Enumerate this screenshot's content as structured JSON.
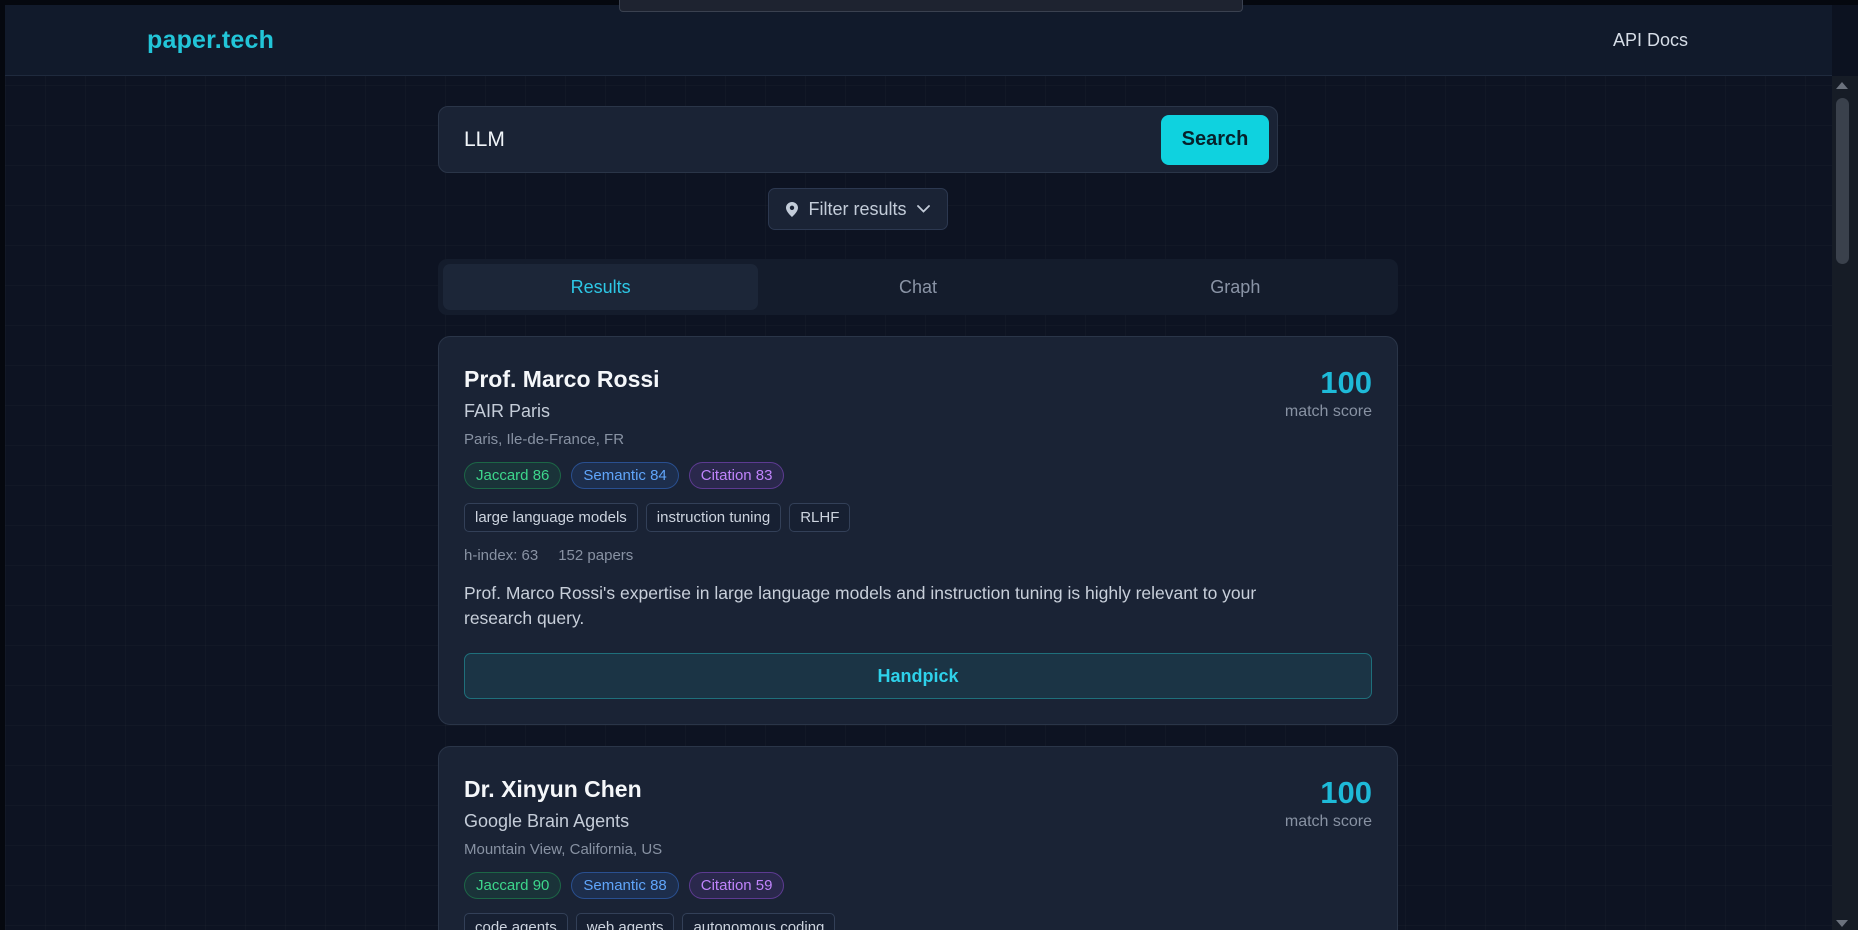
{
  "header": {
    "brand": "paper.tech",
    "api_docs": "API Docs"
  },
  "search": {
    "query": "LLM",
    "placeholder": "",
    "button": "Search"
  },
  "filter": {
    "label": "Filter results",
    "icon": "map-pin-icon",
    "chevron": "chevron-down-icon"
  },
  "tabs": [
    {
      "label": "Results",
      "active": true
    },
    {
      "label": "Chat",
      "active": false
    },
    {
      "label": "Graph",
      "active": false
    }
  ],
  "results": [
    {
      "name": "Prof. Marco Rossi",
      "org": "FAIR Paris",
      "location": "Paris, Ile-de-France, FR",
      "score": "100",
      "score_label": "match score",
      "metrics": {
        "jaccard": "Jaccard 86",
        "semantic": "Semantic 84",
        "citation": "Citation 83"
      },
      "tags": [
        "large language models",
        "instruction tuning",
        "RLHF"
      ],
      "h_index": "h-index: 63",
      "papers": "152 papers",
      "description": "Prof. Marco Rossi's expertise in large language models and instruction tuning is highly relevant to your research query.",
      "action": "Handpick"
    },
    {
      "name": "Dr. Xinyun Chen",
      "org": "Google Brain Agents",
      "location": "Mountain View, California, US",
      "score": "100",
      "score_label": "match score",
      "metrics": {
        "jaccard": "Jaccard 90",
        "semantic": "Semantic 88",
        "citation": "Citation 59"
      },
      "tags": [
        "code agents",
        "web agents",
        "autonomous coding"
      ]
    }
  ],
  "colors": {
    "accent": "#22c5d8",
    "background": "#0d1322",
    "card": "#1a2335",
    "jaccard": "#3dd68c",
    "semantic": "#60a5fa",
    "citation": "#c084fc"
  }
}
